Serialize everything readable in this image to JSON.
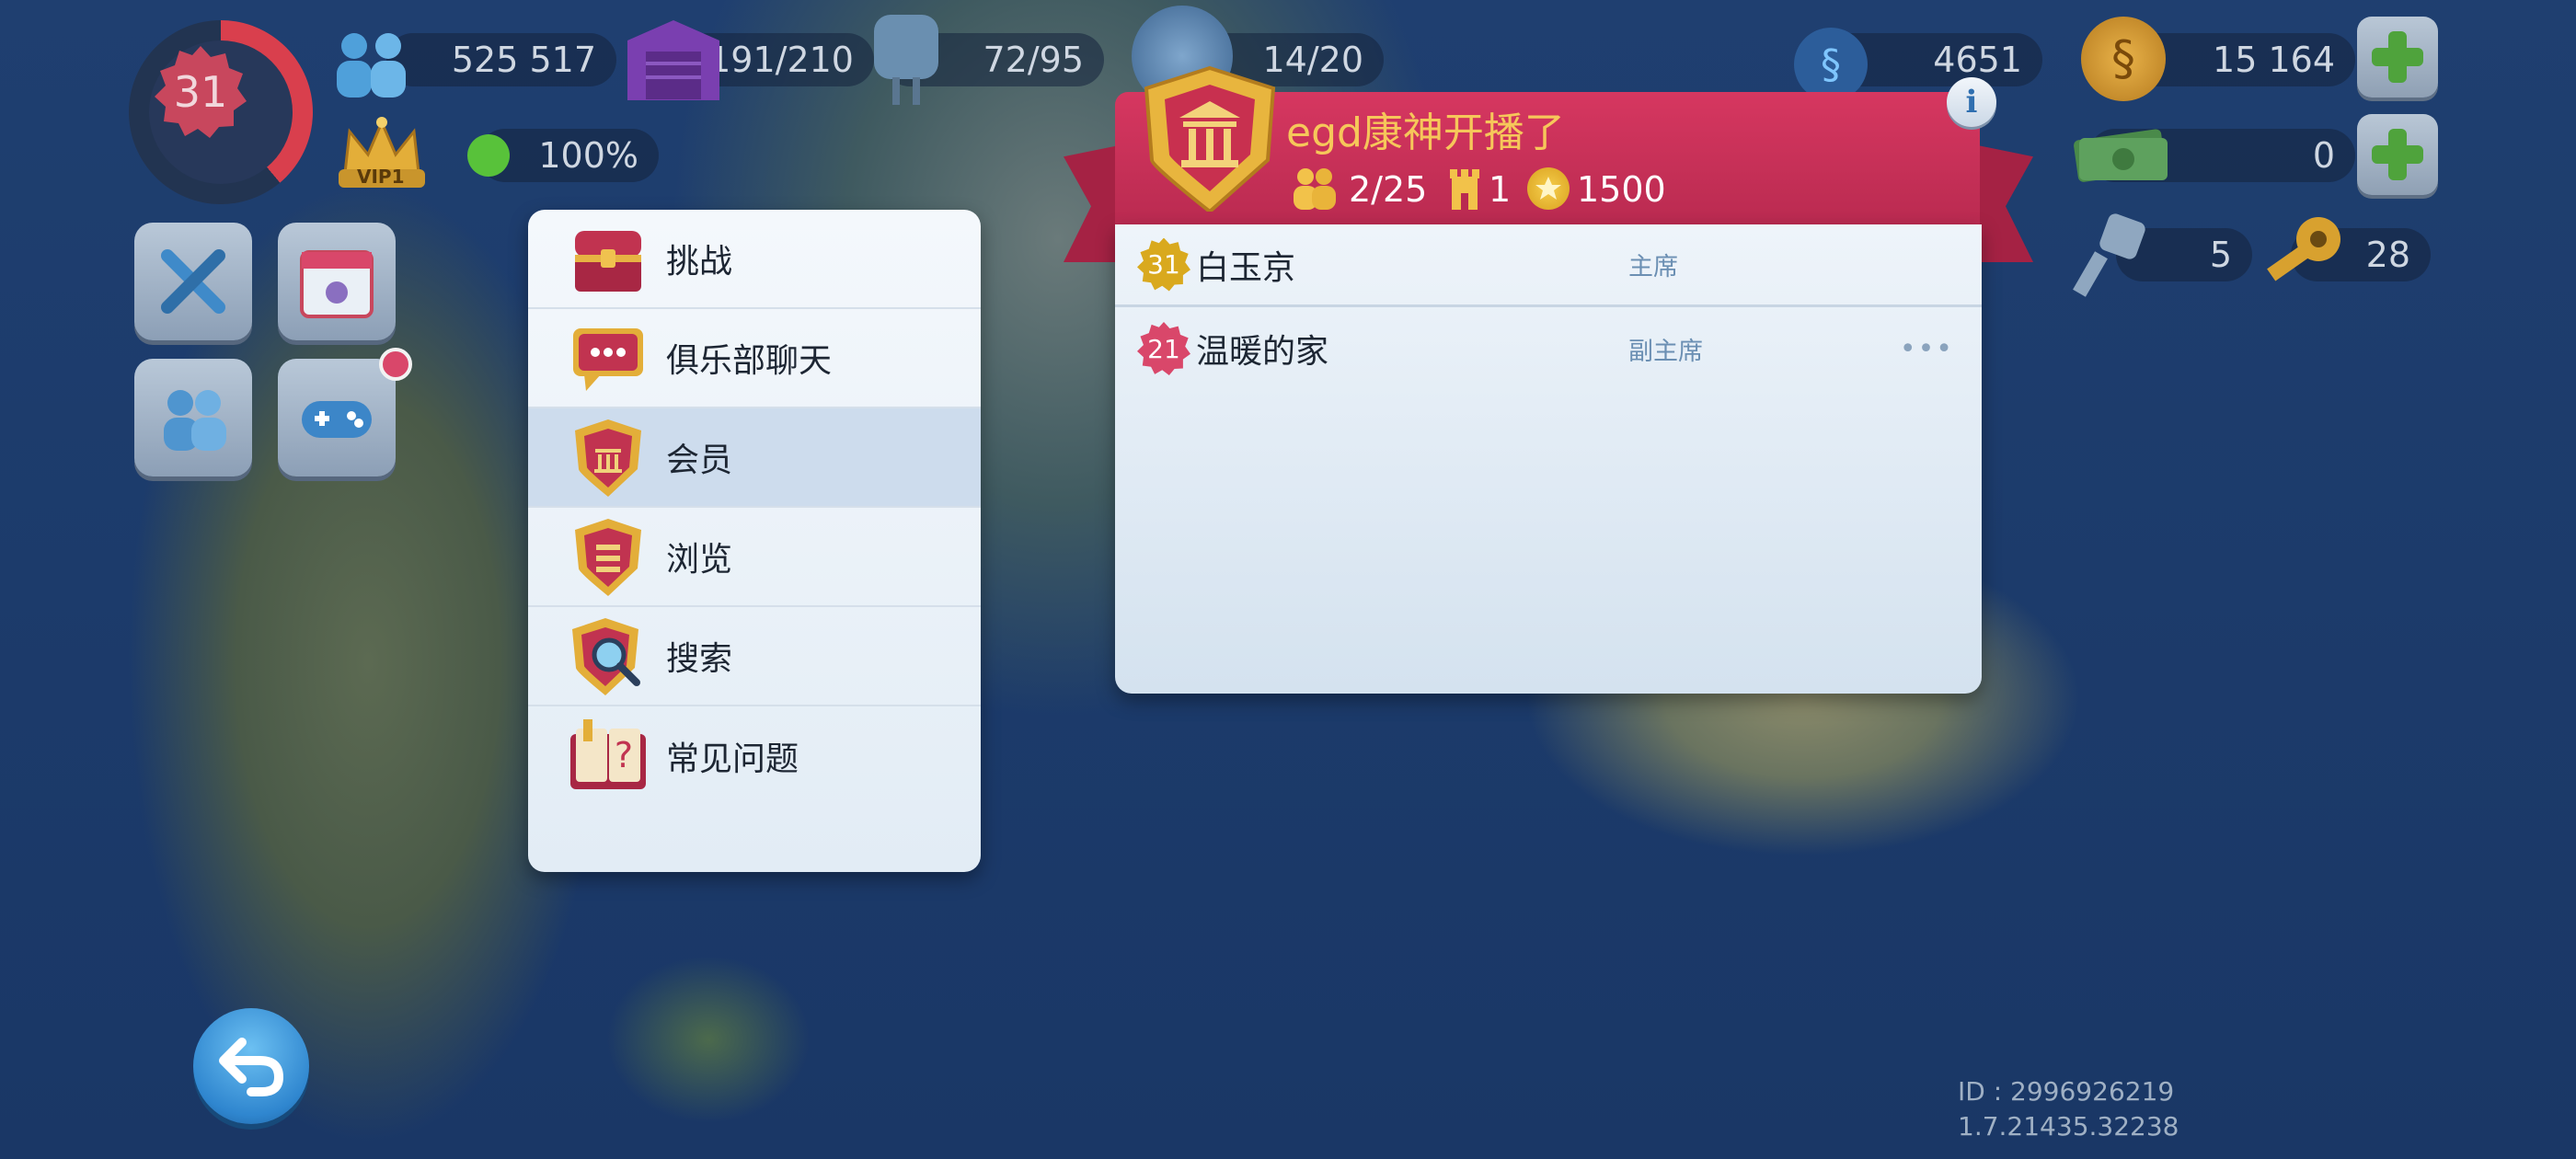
{
  "hud": {
    "level": "31",
    "vip_label": "VIP1",
    "population": "525 517",
    "happiness": "100%",
    "storage": "191/210",
    "water": "72/95",
    "workers": "14/20",
    "neosimoleons": "4651",
    "simoleons": "15 164",
    "simcash": "0",
    "golden_keys_small": "5",
    "golden_keys": "28"
  },
  "menu": {
    "items": [
      {
        "label": "挑战",
        "icon": "treasure-chest-icon"
      },
      {
        "label": "俱乐部聊天",
        "icon": "chat-bubble-icon"
      },
      {
        "label": "会员",
        "icon": "club-shield-icon"
      },
      {
        "label": "浏览",
        "icon": "list-shield-icon"
      },
      {
        "label": "搜索",
        "icon": "magnifier-shield-icon"
      },
      {
        "label": "常见问题",
        "icon": "faq-book-icon"
      }
    ],
    "active_index": 2
  },
  "club": {
    "name": "egd康神开播了",
    "members_count": "2/25",
    "wars": "1",
    "points": "1500",
    "members": [
      {
        "level": "31",
        "name": "白玉京",
        "role": "主席",
        "level_color": "#d9a91e"
      },
      {
        "level": "21",
        "name": "温暖的家",
        "role": "副主席",
        "level_color": "#d9476a"
      }
    ],
    "more_label": "•••"
  },
  "footer": {
    "id_text": "ID : 2996926219",
    "version": "1.7.21435.32238"
  },
  "colors": {
    "accent_red": "#c93055",
    "panel": "#e9f1f8",
    "gold": "#e4b13a"
  }
}
